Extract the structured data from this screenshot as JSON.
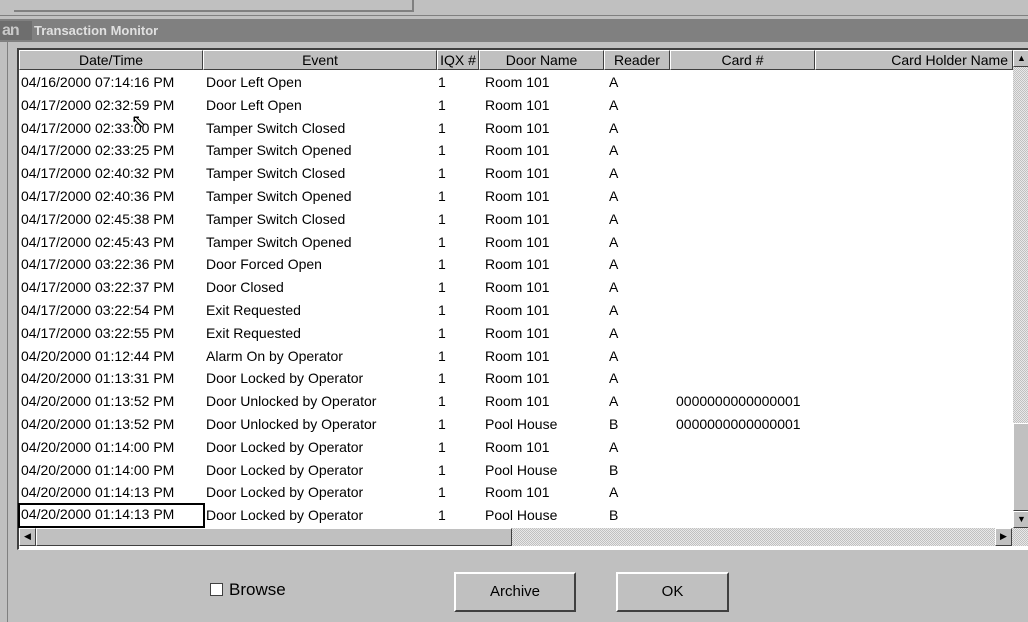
{
  "window": {
    "logo_text": "an",
    "title": "Transaction Monitor"
  },
  "table": {
    "columns": [
      "Date/Time",
      "Event",
      "IQX #",
      "Door Name",
      "Reader",
      "Card #",
      "Card Holder Name"
    ],
    "rows": [
      [
        "04/16/2000 07:14:16 PM",
        "Door Left Open",
        "1",
        "Room 101",
        "A",
        ""
      ],
      [
        "04/17/2000 02:32:59 PM",
        "Door Left Open",
        "1",
        "Room 101",
        "A",
        ""
      ],
      [
        "04/17/2000 02:33:00 PM",
        "Tamper Switch Closed",
        "1",
        "Room 101",
        "A",
        ""
      ],
      [
        "04/17/2000 02:33:25 PM",
        "Tamper Switch Opened",
        "1",
        "Room 101",
        "A",
        ""
      ],
      [
        "04/17/2000 02:40:32 PM",
        "Tamper Switch Closed",
        "1",
        "Room 101",
        "A",
        ""
      ],
      [
        "04/17/2000 02:40:36 PM",
        "Tamper Switch Opened",
        "1",
        "Room 101",
        "A",
        ""
      ],
      [
        "04/17/2000 02:45:38 PM",
        "Tamper Switch Closed",
        "1",
        "Room 101",
        "A",
        ""
      ],
      [
        "04/17/2000 02:45:43 PM",
        "Tamper Switch Opened",
        "1",
        "Room 101",
        "A",
        ""
      ],
      [
        "04/17/2000 03:22:36 PM",
        "Door Forced Open",
        "1",
        "Room 101",
        "A",
        ""
      ],
      [
        "04/17/2000 03:22:37 PM",
        "Door Closed",
        "1",
        "Room 101",
        "A",
        ""
      ],
      [
        "04/17/2000 03:22:54 PM",
        "Exit Requested",
        "1",
        "Room 101",
        "A",
        ""
      ],
      [
        "04/17/2000 03:22:55 PM",
        "Exit Requested",
        "1",
        "Room 101",
        "A",
        ""
      ],
      [
        "04/20/2000 01:12:44 PM",
        "Alarm On by Operator",
        "1",
        "Room 101",
        "A",
        ""
      ],
      [
        "04/20/2000 01:13:31 PM",
        "Door Locked by Operator",
        "1",
        "Room 101",
        "A",
        ""
      ],
      [
        "04/20/2000 01:13:52 PM",
        "Door Unlocked by Operator",
        "1",
        "Room 101",
        "A",
        "0000000000000001"
      ],
      [
        "04/20/2000 01:13:52 PM",
        "Door Unlocked by Operator",
        "1",
        "Pool House",
        "B",
        "0000000000000001"
      ],
      [
        "04/20/2000 01:14:00 PM",
        "Door Locked by Operator",
        "1",
        "Room 101",
        "A",
        ""
      ],
      [
        "04/20/2000 01:14:00 PM",
        "Door Locked by Operator",
        "1",
        "Pool House",
        "B",
        ""
      ],
      [
        "04/20/2000 01:14:13 PM",
        "Door Locked by Operator",
        "1",
        "Room 101",
        "A",
        ""
      ],
      [
        "04/20/2000 01:14:13 PM",
        "Door Locked by Operator",
        "1",
        "Pool House",
        "B",
        ""
      ]
    ],
    "selected_row": 19
  },
  "footer": {
    "browse_label": "Browse",
    "browse_checked": false,
    "archive_label": "Archive",
    "ok_label": "OK"
  }
}
